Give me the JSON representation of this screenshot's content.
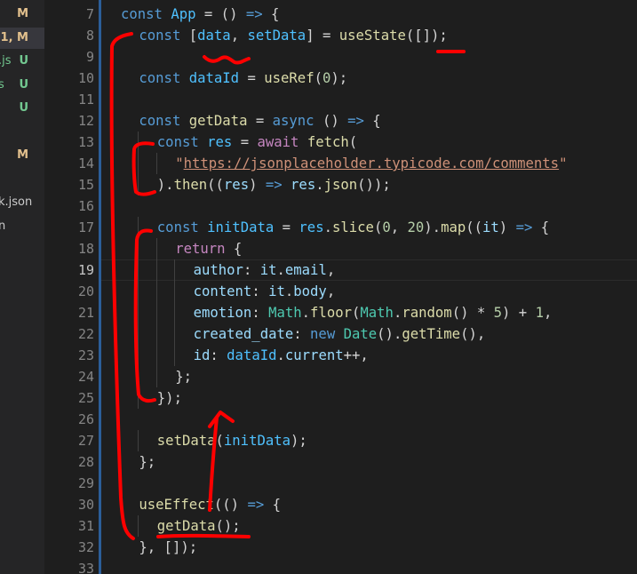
{
  "colors": {
    "background": "#1e1e1e",
    "sidebar": "#252526",
    "line_number": "#858585",
    "annotation_red": "#ff0000",
    "modified_badge": "#e2c08d",
    "untracked_badge": "#73c991"
  },
  "sidebar": {
    "items": [
      {
        "name": "",
        "badge": "M",
        "active": false
      },
      {
        "name": "",
        "badge": "1, M",
        "active": true
      },
      {
        "name": ".js",
        "badge": "U",
        "active": false
      },
      {
        "name": "s",
        "badge": "U",
        "active": false
      },
      {
        "name": "",
        "badge": "U",
        "active": false
      },
      {
        "name": "",
        "badge": "",
        "active": false
      },
      {
        "name": "",
        "badge": "M",
        "active": false
      },
      {
        "name": "",
        "badge": "",
        "active": false
      },
      {
        "name": "k.json",
        "badge": "",
        "active": false
      },
      {
        "name": "n",
        "badge": "",
        "active": false
      }
    ]
  },
  "editor": {
    "current_line": 19,
    "lines": [
      {
        "n": "7",
        "indent": 0,
        "t": [
          [
            "kw",
            "const"
          ],
          [
            "pun",
            " "
          ],
          [
            "cst",
            "App"
          ],
          [
            "pun",
            " = () "
          ],
          [
            "kw",
            "=>"
          ],
          [
            "pun",
            " {"
          ]
        ]
      },
      {
        "n": "8",
        "indent": 1,
        "t": [
          [
            "kw",
            "const"
          ],
          [
            "pun",
            " ["
          ],
          [
            "cst",
            "data"
          ],
          [
            "pun",
            ", "
          ],
          [
            "cst",
            "setData"
          ],
          [
            "pun",
            "] = "
          ],
          [
            "fn",
            "useState"
          ],
          [
            "pun",
            "([]);"
          ]
        ]
      },
      {
        "n": "9",
        "indent": 0,
        "t": []
      },
      {
        "n": "10",
        "indent": 1,
        "t": [
          [
            "kw",
            "const"
          ],
          [
            "pun",
            " "
          ],
          [
            "cst",
            "dataId"
          ],
          [
            "pun",
            " = "
          ],
          [
            "fn",
            "useRef"
          ],
          [
            "pun",
            "("
          ],
          [
            "num",
            "0"
          ],
          [
            "pun",
            ");"
          ]
        ]
      },
      {
        "n": "11",
        "indent": 0,
        "t": []
      },
      {
        "n": "12",
        "indent": 1,
        "t": [
          [
            "kw",
            "const"
          ],
          [
            "pun",
            " "
          ],
          [
            "fn",
            "getData"
          ],
          [
            "pun",
            " = "
          ],
          [
            "kw",
            "async"
          ],
          [
            "pun",
            " () "
          ],
          [
            "kw",
            "=>"
          ],
          [
            "pun",
            " {"
          ]
        ]
      },
      {
        "n": "13",
        "indent": 2,
        "t": [
          [
            "kw",
            "const"
          ],
          [
            "pun",
            " "
          ],
          [
            "cst",
            "res"
          ],
          [
            "pun",
            " = "
          ],
          [
            "ctl",
            "await"
          ],
          [
            "pun",
            " "
          ],
          [
            "fn",
            "fetch"
          ],
          [
            "pun",
            "("
          ]
        ]
      },
      {
        "n": "14",
        "indent": 3,
        "t": [
          [
            "str",
            "\""
          ],
          [
            "url",
            "https://jsonplaceholder.typicode.com/comments"
          ],
          [
            "str",
            "\""
          ]
        ]
      },
      {
        "n": "15",
        "indent": 2,
        "t": [
          [
            "pun",
            ")."
          ],
          [
            "fn",
            "then"
          ],
          [
            "pun",
            "(("
          ],
          [
            "var",
            "res"
          ],
          [
            "pun",
            ") "
          ],
          [
            "kw",
            "=>"
          ],
          [
            "pun",
            " "
          ],
          [
            "var",
            "res"
          ],
          [
            "pun",
            "."
          ],
          [
            "fn",
            "json"
          ],
          [
            "pun",
            "());"
          ]
        ]
      },
      {
        "n": "16",
        "indent": 0,
        "t": []
      },
      {
        "n": "17",
        "indent": 2,
        "t": [
          [
            "kw",
            "const"
          ],
          [
            "pun",
            " "
          ],
          [
            "cst",
            "initData"
          ],
          [
            "pun",
            " = "
          ],
          [
            "cst",
            "res"
          ],
          [
            "pun",
            "."
          ],
          [
            "fn",
            "slice"
          ],
          [
            "pun",
            "("
          ],
          [
            "num",
            "0"
          ],
          [
            "pun",
            ", "
          ],
          [
            "num",
            "20"
          ],
          [
            "pun",
            ")."
          ],
          [
            "fn",
            "map"
          ],
          [
            "pun",
            "(("
          ],
          [
            "var",
            "it"
          ],
          [
            "pun",
            ") "
          ],
          [
            "kw",
            "=>"
          ],
          [
            "pun",
            " {"
          ]
        ]
      },
      {
        "n": "18",
        "indent": 3,
        "t": [
          [
            "ctl",
            "return"
          ],
          [
            "pun",
            " {"
          ]
        ]
      },
      {
        "n": "19",
        "indent": 4,
        "t": [
          [
            "var",
            "author"
          ],
          [
            "pun",
            ": "
          ],
          [
            "var",
            "it"
          ],
          [
            "pun",
            "."
          ],
          [
            "var",
            "email"
          ],
          [
            "pun",
            ","
          ]
        ]
      },
      {
        "n": "20",
        "indent": 4,
        "t": [
          [
            "var",
            "content"
          ],
          [
            "pun",
            ": "
          ],
          [
            "var",
            "it"
          ],
          [
            "pun",
            "."
          ],
          [
            "var",
            "body"
          ],
          [
            "pun",
            ","
          ]
        ]
      },
      {
        "n": "21",
        "indent": 4,
        "t": [
          [
            "var",
            "emotion"
          ],
          [
            "pun",
            ": "
          ],
          [
            "cls",
            "Math"
          ],
          [
            "pun",
            "."
          ],
          [
            "fn",
            "floor"
          ],
          [
            "pun",
            "("
          ],
          [
            "cls",
            "Math"
          ],
          [
            "pun",
            "."
          ],
          [
            "fn",
            "random"
          ],
          [
            "pun",
            "() * "
          ],
          [
            "num",
            "5"
          ],
          [
            "pun",
            ") + "
          ],
          [
            "num",
            "1"
          ],
          [
            "pun",
            ","
          ]
        ]
      },
      {
        "n": "22",
        "indent": 4,
        "t": [
          [
            "var",
            "created_date"
          ],
          [
            "pun",
            ": "
          ],
          [
            "kw",
            "new"
          ],
          [
            "pun",
            " "
          ],
          [
            "cls",
            "Date"
          ],
          [
            "pun",
            "()."
          ],
          [
            "fn",
            "getTime"
          ],
          [
            "pun",
            "(),"
          ]
        ]
      },
      {
        "n": "23",
        "indent": 4,
        "t": [
          [
            "var",
            "id"
          ],
          [
            "pun",
            ": "
          ],
          [
            "cst",
            "dataId"
          ],
          [
            "pun",
            "."
          ],
          [
            "var",
            "current"
          ],
          [
            "pun",
            "++,"
          ]
        ]
      },
      {
        "n": "24",
        "indent": 3,
        "t": [
          [
            "pun",
            "};"
          ]
        ]
      },
      {
        "n": "25",
        "indent": 2,
        "t": [
          [
            "pun",
            "});"
          ]
        ]
      },
      {
        "n": "26",
        "indent": 0,
        "t": []
      },
      {
        "n": "27",
        "indent": 2,
        "t": [
          [
            "fn",
            "setData"
          ],
          [
            "pun",
            "("
          ],
          [
            "cst",
            "initData"
          ],
          [
            "pun",
            ");"
          ]
        ]
      },
      {
        "n": "28",
        "indent": 1,
        "t": [
          [
            "pun",
            "};"
          ]
        ]
      },
      {
        "n": "29",
        "indent": 0,
        "t": []
      },
      {
        "n": "30",
        "indent": 1,
        "t": [
          [
            "fn",
            "useEffect"
          ],
          [
            "pun",
            "(() "
          ],
          [
            "kw",
            "=>"
          ],
          [
            "pun",
            " {"
          ]
        ]
      },
      {
        "n": "31",
        "indent": 2,
        "t": [
          [
            "fn",
            "getData"
          ],
          [
            "pun",
            "();"
          ]
        ]
      },
      {
        "n": "32",
        "indent": 1,
        "t": [
          [
            "pun",
            "}, []);"
          ]
        ]
      },
      {
        "n": "33",
        "indent": 0,
        "t": []
      }
    ]
  }
}
